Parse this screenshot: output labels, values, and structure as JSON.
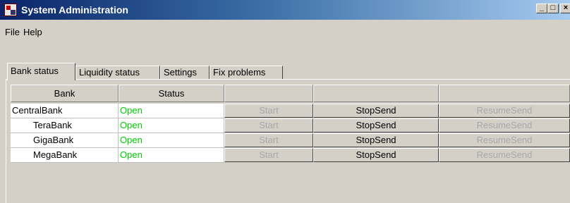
{
  "window": {
    "title": "System Administration",
    "controls": {
      "minimize": "_",
      "maximize": "□",
      "close": "×"
    }
  },
  "menu": [
    "File",
    "Help"
  ],
  "tabs": [
    {
      "label": "Bank status",
      "active": true
    },
    {
      "label": "Liquidity status",
      "active": false
    },
    {
      "label": "Settings",
      "active": false
    },
    {
      "label": "Fix problems",
      "active": false
    }
  ],
  "table": {
    "headers": [
      "Bank",
      "Status",
      "",
      "",
      ""
    ],
    "rows": [
      {
        "bank": "CentralBank",
        "indent": false,
        "status": "Open",
        "start": "Start",
        "stop": "StopSend",
        "resume": "ResumeSend"
      },
      {
        "bank": "TeraBank",
        "indent": true,
        "status": "Open",
        "start": "Start",
        "stop": "StopSend",
        "resume": "ResumeSend"
      },
      {
        "bank": "GigaBank",
        "indent": true,
        "status": "Open",
        "start": "Start",
        "stop": "StopSend",
        "resume": "ResumeSend"
      },
      {
        "bank": "MegaBank",
        "indent": true,
        "status": "Open",
        "start": "Start",
        "stop": "StopSend",
        "resume": "ResumeSend"
      }
    ]
  },
  "colors": {
    "status_open": "#00d000",
    "disabled_text": "#a8a8a8",
    "window_bg": "#d4d0c8",
    "titlebar_start": "#0a246a",
    "titlebar_end": "#a6caf0"
  }
}
